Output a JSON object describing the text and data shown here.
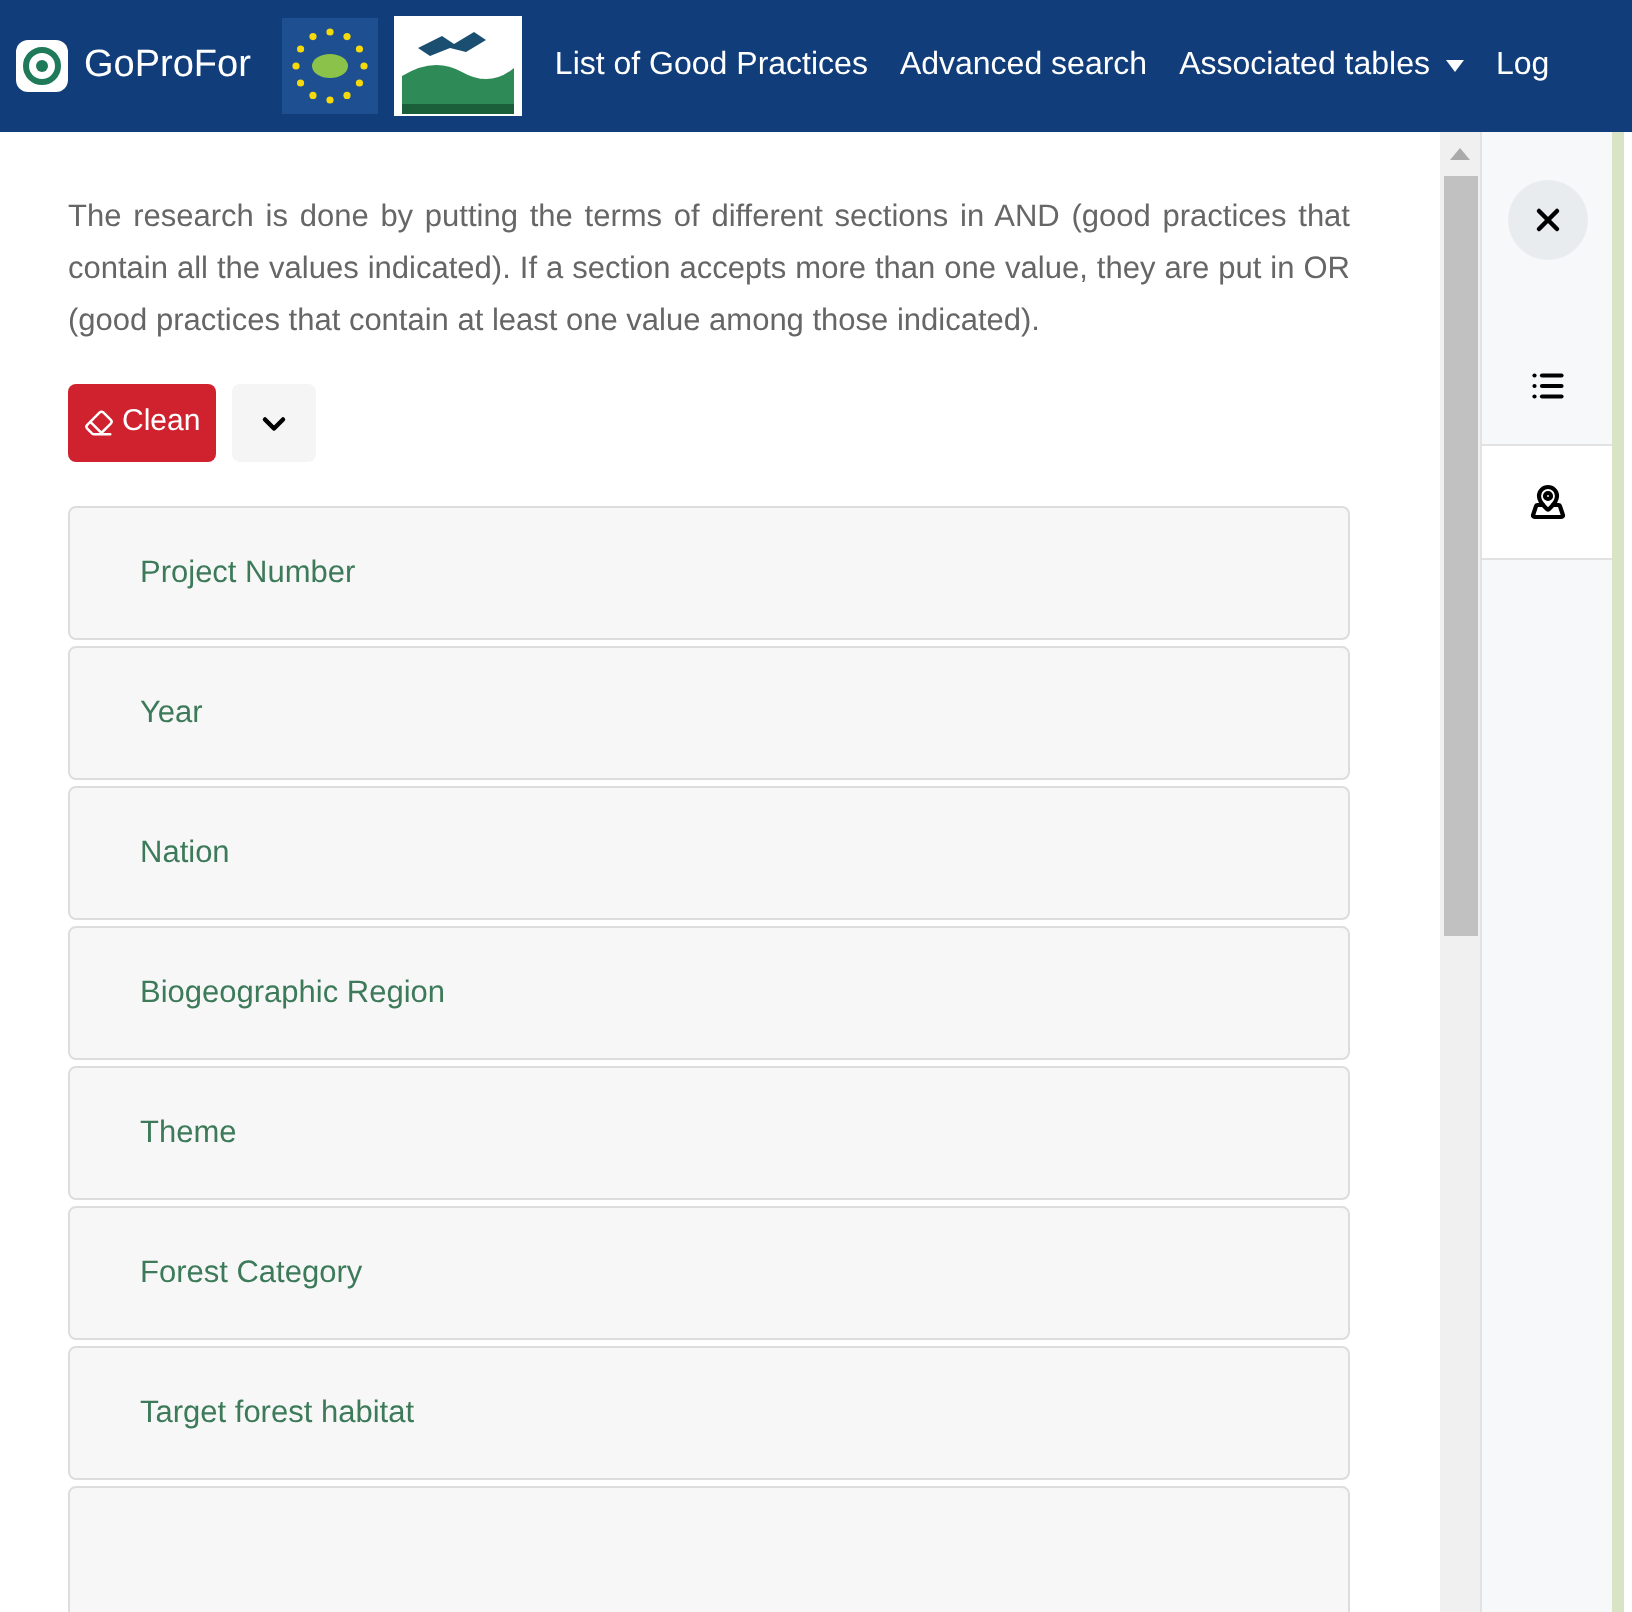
{
  "navbar": {
    "brand": "GoProFor",
    "links": [
      {
        "label": "List of Good Practices",
        "dropdown": false
      },
      {
        "label": "Advanced search",
        "dropdown": false
      },
      {
        "label": "Associated tables",
        "dropdown": true
      },
      {
        "label": "Log",
        "dropdown": false
      }
    ]
  },
  "description": "The research is done by putting the terms of different sections in AND (good practices that contain all the values indicated). If a section accepts more than one value, they are put in OR (good practices that contain at least one value among those indicated).",
  "clean_button": "Clean",
  "sections": [
    {
      "label": "Project Number"
    },
    {
      "label": "Year"
    },
    {
      "label": "Nation"
    },
    {
      "label": "Biogeographic Region"
    },
    {
      "label": "Theme"
    },
    {
      "label": "Forest Category"
    },
    {
      "label": "Target forest habitat"
    }
  ],
  "side_tabs": [
    {
      "kind": "list",
      "selected": false
    },
    {
      "kind": "map",
      "selected": true
    }
  ]
}
